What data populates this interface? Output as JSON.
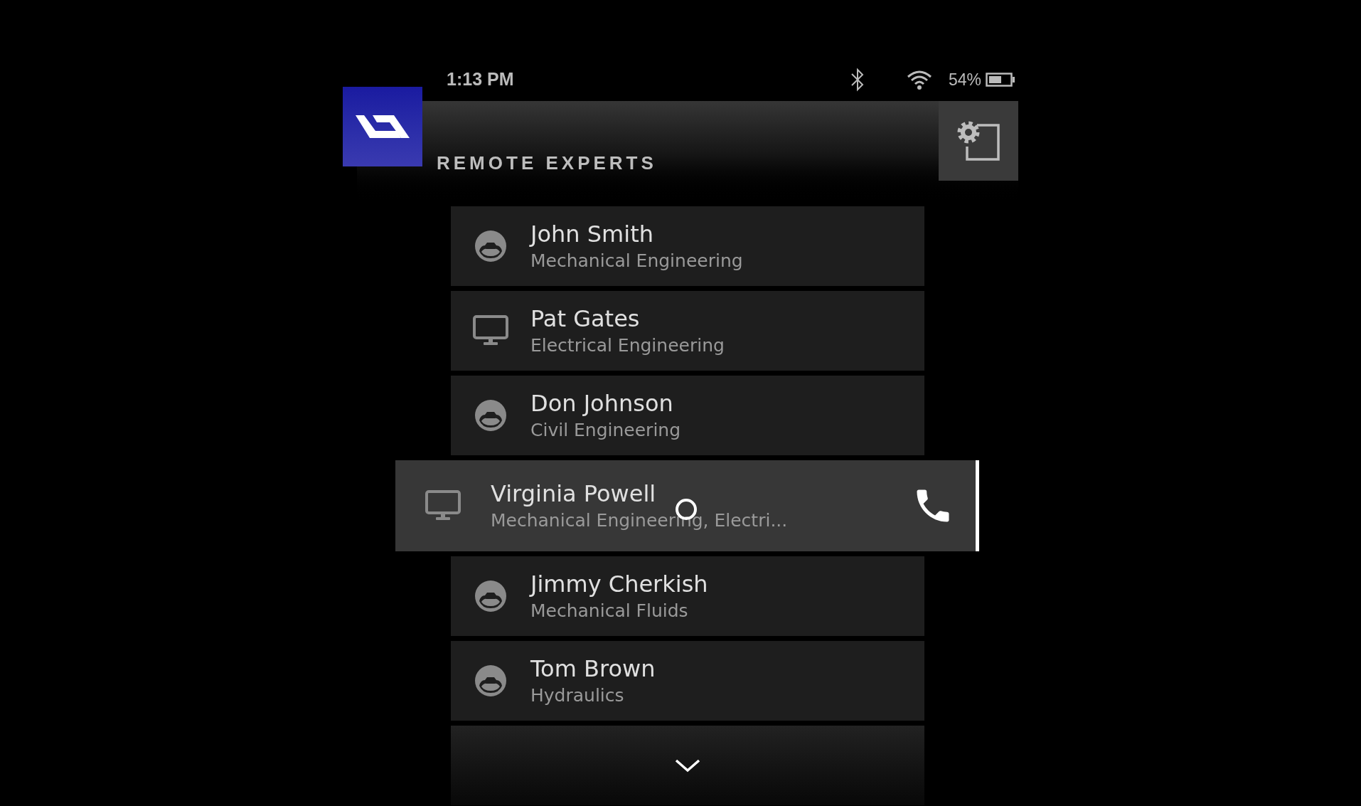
{
  "status_bar": {
    "time": "1:13 PM",
    "battery": "54%"
  },
  "header": {
    "title": "REMOTE EXPERTS"
  },
  "experts": [
    {
      "name": "John Smith",
      "department": "Mechanical Engineering",
      "kind": "person",
      "selected": false
    },
    {
      "name": "Pat Gates",
      "department": "Electrical Engineering",
      "kind": "desktop",
      "selected": false
    },
    {
      "name": "Don Johnson",
      "department": "Civil Engineering",
      "kind": "person",
      "selected": false
    },
    {
      "name": "Virginia Powell",
      "department": "Mechanical Engineering, Electri...",
      "kind": "desktop",
      "selected": true
    },
    {
      "name": "Jimmy Cherkish",
      "department": "Mechanical Fluids",
      "kind": "person",
      "selected": false
    },
    {
      "name": "Tom Brown",
      "department": "Hydraulics",
      "kind": "person",
      "selected": false
    }
  ]
}
